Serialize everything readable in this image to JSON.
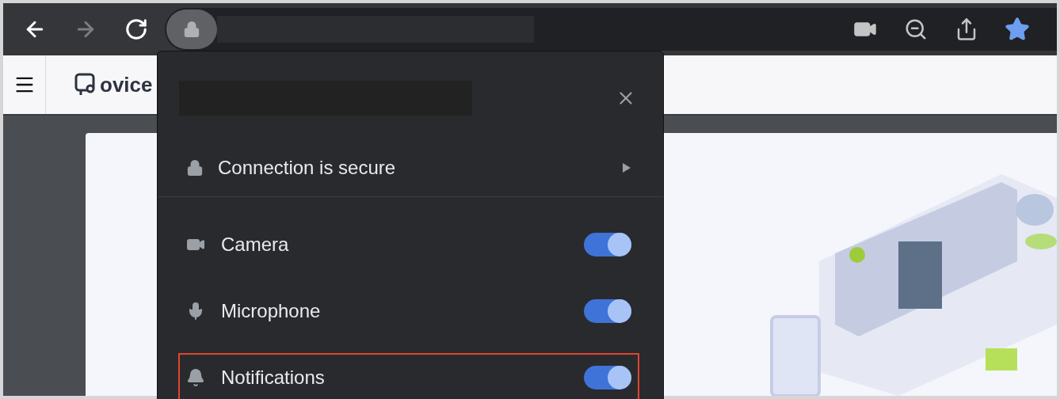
{
  "toolbar": {
    "nav": [
      {
        "kind": "back",
        "disabled": false
      },
      {
        "kind": "forward",
        "disabled": true
      },
      {
        "kind": "reload",
        "disabled": false
      }
    ],
    "bookmarked": true
  },
  "site": {
    "logo_text": "ovice"
  },
  "site_info": {
    "connection": "Connection is secure",
    "permissions": [
      {
        "kind": "camera",
        "label": "Camera",
        "on": true,
        "highlighted": false
      },
      {
        "kind": "microphone",
        "label": "Microphone",
        "on": true,
        "highlighted": false
      },
      {
        "kind": "notifications",
        "label": "Notifications",
        "on": true,
        "highlighted": true
      }
    ]
  }
}
